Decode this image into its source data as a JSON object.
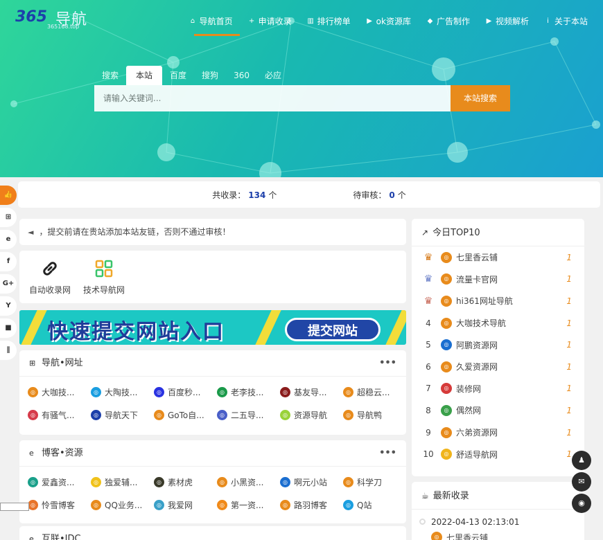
{
  "logo": {
    "mark": "365",
    "name": "导航",
    "domain": "365168.top"
  },
  "nav": [
    {
      "label": "导航首页",
      "icon": "home-icon",
      "glyph": "⌂"
    },
    {
      "label": "申请收录",
      "icon": "plus-square-icon",
      "glyph": "+"
    },
    {
      "label": "排行榜单",
      "icon": "bar-chart-icon",
      "glyph": "▥"
    },
    {
      "label": "ok资源库",
      "icon": "play-square-icon",
      "glyph": "▶"
    },
    {
      "label": "广告制作",
      "icon": "car-icon",
      "glyph": "◆"
    },
    {
      "label": "视频解析",
      "icon": "video-icon",
      "glyph": "▶"
    },
    {
      "label": "关于本站",
      "icon": "info-icon",
      "glyph": "i"
    }
  ],
  "search": {
    "tabs": [
      "搜索",
      "本站",
      "百度",
      "搜狗",
      "360",
      "必应"
    ],
    "active_tab": "本站",
    "placeholder": "请输入关键词...",
    "button": "本站搜索"
  },
  "stats": {
    "total_label": "共收录：",
    "total": "134",
    "total_unit": "个",
    "pending_label": "待审核：",
    "pending": "0",
    "pending_unit": "个"
  },
  "left_share": [
    "like-icon",
    "windows-icon",
    "ie-icon",
    "facebook-icon",
    "google-plus-icon",
    "yahoo-icon",
    "video-icon",
    "attachment-icon"
  ],
  "notice": "，提交前请在贵站添加本站友链，否则不通过审核！",
  "quick_links": [
    {
      "label": "自动收录网",
      "icon": "link-icon"
    },
    {
      "label": "技术导航网",
      "icon": "grid-icon"
    }
  ],
  "banner": {
    "text": "快速提交网站入口",
    "button": "提交网站"
  },
  "sections": [
    {
      "title": "导航•网址",
      "icon": "windows-icon",
      "more": "•••",
      "items": [
        {
          "label": "大咖技...",
          "color": "#e88b1c"
        },
        {
          "label": "大陶技...",
          "color": "#1a9ee0"
        },
        {
          "label": "百度秒...",
          "color": "#2932e1"
        },
        {
          "label": "老李技...",
          "color": "#1a9a4a"
        },
        {
          "label": "基友导...",
          "color": "#8a1c1c"
        },
        {
          "label": "超稳云...",
          "color": "#e88b1c"
        },
        {
          "label": "有骚气...",
          "color": "#d63b4a"
        },
        {
          "label": "导航天下",
          "color": "#1c3faa"
        },
        {
          "label": "GoTo自...",
          "color": "#e88b1c"
        },
        {
          "label": "二五导...",
          "color": "#4a5fc8"
        },
        {
          "label": "资源导航",
          "color": "#9ad23a"
        },
        {
          "label": "导航鸭",
          "color": "#e88b1c"
        }
      ]
    },
    {
      "title": "博客•资源",
      "icon": "ie-icon",
      "more": "•••",
      "items": [
        {
          "label": "爱鑫资...",
          "color": "#1aa08a"
        },
        {
          "label": "独爱辅...",
          "color": "#f0c21a"
        },
        {
          "label": "素材虎",
          "color": "#3a3a2a"
        },
        {
          "label": "小黑资...",
          "color": "#e88b1c"
        },
        {
          "label": "啊元小站",
          "color": "#1a6ed0"
        },
        {
          "label": "科学刀",
          "color": "#e88b1c"
        },
        {
          "label": "怜雪博客",
          "color": "#e8742a"
        },
        {
          "label": "QQ业务...",
          "color": "#e88b1c"
        },
        {
          "label": "我爱网",
          "color": "#3aa0c8"
        },
        {
          "label": "第一资...",
          "color": "#f08a1a"
        },
        {
          "label": "路羽博客",
          "color": "#e88b1c"
        },
        {
          "label": "Q站",
          "color": "#1a9ee0"
        }
      ]
    }
  ],
  "idc_section": {
    "title": "互联•IDC"
  },
  "top10": {
    "title": "今日TOP10",
    "rows": [
      {
        "rank": "1",
        "name": "七里香云铺",
        "count": "1",
        "crown": "#d67a1a",
        "color": "#e88b1c"
      },
      {
        "rank": "2",
        "name": "流量卡官网",
        "count": "1",
        "crown": "#6a7fc8",
        "color": "#e88b1c"
      },
      {
        "rank": "3",
        "name": "hi361网址导航",
        "count": "1",
        "crown": "#c86a5a",
        "color": "#e88b1c"
      },
      {
        "rank": "4",
        "name": "大咖技术导航",
        "count": "1",
        "color": "#e88b1c"
      },
      {
        "rank": "5",
        "name": "阿鹏资源网",
        "count": "1",
        "color": "#1a6ed0"
      },
      {
        "rank": "6",
        "name": "久爱资源网",
        "count": "1",
        "color": "#e88b1c"
      },
      {
        "rank": "7",
        "name": "装修网",
        "count": "1",
        "color": "#d63b3a"
      },
      {
        "rank": "8",
        "name": "偶然网",
        "count": "1",
        "color": "#3aa04a"
      },
      {
        "rank": "9",
        "name": "六弟资源网",
        "count": "1",
        "color": "#e88b1c"
      },
      {
        "rank": "10",
        "name": "舒适导航网",
        "count": "1",
        "color": "#f0b41a"
      }
    ]
  },
  "latest": {
    "title": "最新收录",
    "date": "2022-04-13 02:13:01",
    "site": "七里香云铺"
  },
  "floats": [
    "qq-icon",
    "mail-icon",
    "wechat-icon"
  ],
  "colors": {
    "accent": "#e88b1c",
    "brand": "#1c3faa",
    "hero_start": "#2fd69a",
    "hero_end": "#1aa0d0"
  }
}
